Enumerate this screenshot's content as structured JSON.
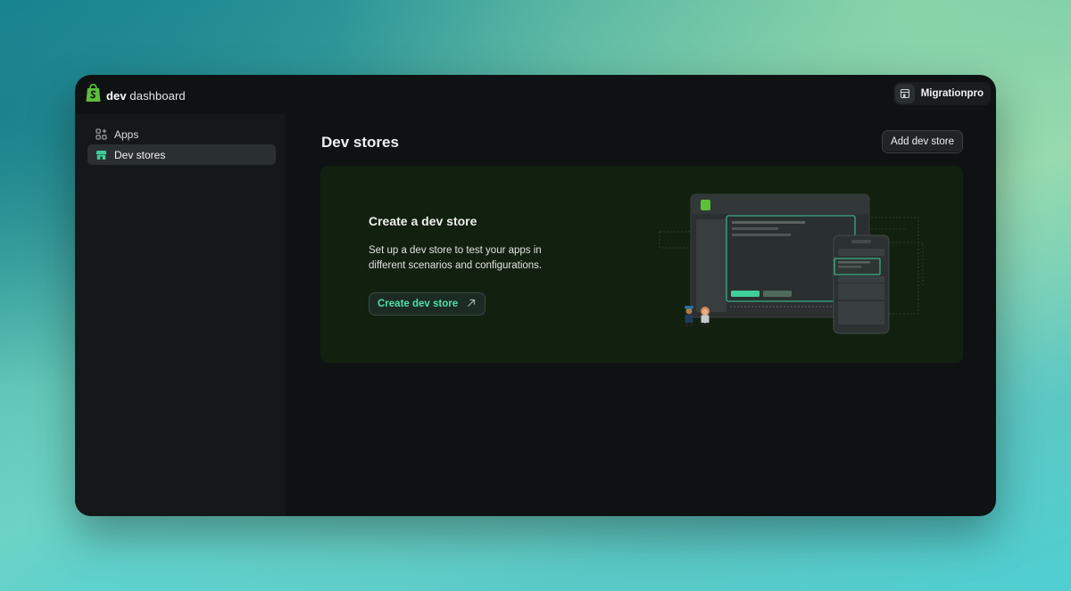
{
  "app": {
    "logo_brand": "dev",
    "logo_rest": "dashboard"
  },
  "account": {
    "name": "Migrationpro",
    "icon": "store-icon"
  },
  "sidebar": {
    "items": [
      {
        "label": "Apps",
        "icon": "apps-icon",
        "active": false
      },
      {
        "label": "Dev stores",
        "icon": "store-icon",
        "active": true
      }
    ]
  },
  "main": {
    "title": "Dev stores",
    "add_button": "Add dev store",
    "empty_state": {
      "title": "Create a dev store",
      "description": "Set up a dev store to test your apps in different scenarios and configurations.",
      "button": "Create dev store",
      "button_icon": "external-arrow-icon"
    }
  },
  "colors": {
    "accent": "#4ee0a6",
    "shopify_green": "#5cbf3a",
    "window_bg": "#0f1213",
    "sidebar_bg": "#151819",
    "card_bg": "#12200f"
  }
}
